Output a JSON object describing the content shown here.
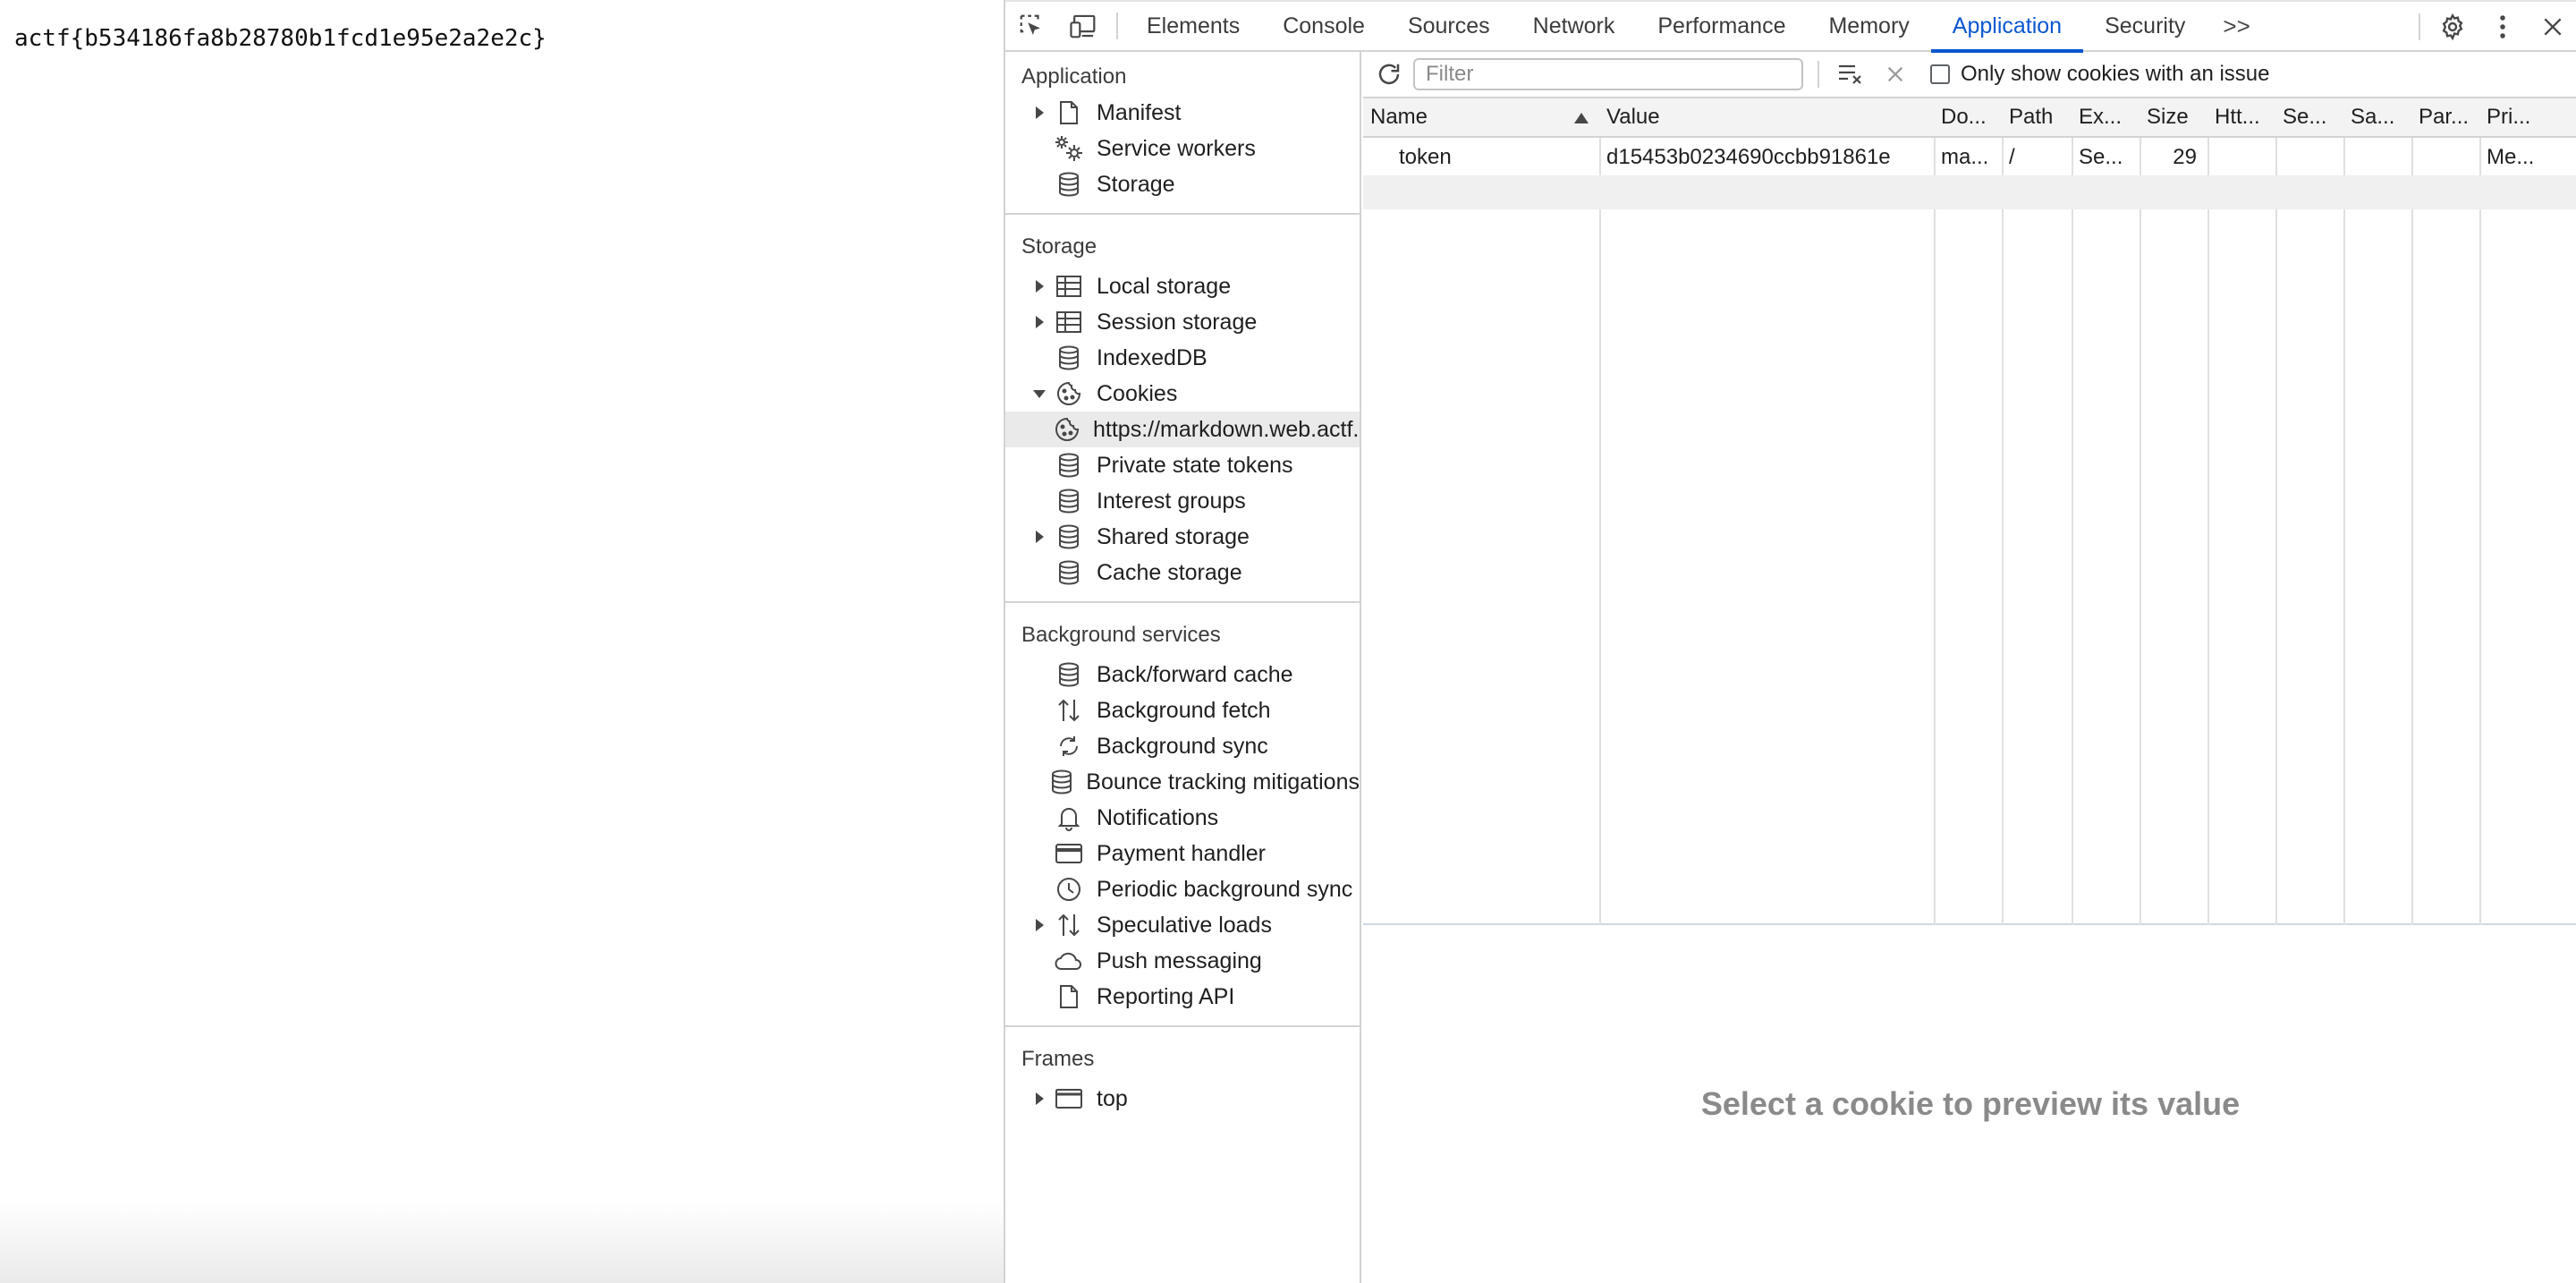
{
  "page": {
    "text": "actf{b534186fa8b28780b1fcd1e95e2a2e2c}"
  },
  "devtools": {
    "tabs": [
      "Elements",
      "Console",
      "Sources",
      "Network",
      "Performance",
      "Memory",
      "Application",
      "Security"
    ],
    "active_tab": "Application",
    "more_tabs": ">>",
    "icons": {
      "inspect": "inspect-element-icon",
      "device": "device-toolbar-icon",
      "settings": "gear-icon",
      "menu": "kebab-menu-icon",
      "close": "close-icon"
    },
    "accent_color": "#0b57d0"
  },
  "sidebar": {
    "application": {
      "title": "Application",
      "items": [
        "Manifest",
        "Service workers",
        "Storage"
      ]
    },
    "storage": {
      "title": "Storage",
      "items": [
        "Local storage",
        "Session storage",
        "IndexedDB",
        "Cookies",
        "https://markdown.web.actf.co",
        "Private state tokens",
        "Interest groups",
        "Shared storage",
        "Cache storage"
      ]
    },
    "background": {
      "title": "Background services",
      "items": [
        "Back/forward cache",
        "Background fetch",
        "Background sync",
        "Bounce tracking mitigations",
        "Notifications",
        "Payment handler",
        "Periodic background sync",
        "Speculative loads",
        "Push messaging",
        "Reporting API"
      ]
    },
    "frames": {
      "title": "Frames",
      "items": [
        "top"
      ]
    }
  },
  "cookies": {
    "filter_placeholder": "Filter",
    "only_issue_label": "Only show cookies with an issue",
    "columns": [
      "Name",
      "Value",
      "Do...",
      "Path",
      "Ex...",
      "Size",
      "Htt...",
      "Se...",
      "Sa...",
      "Par...",
      "Pri..."
    ],
    "rows": [
      {
        "name": "token",
        "value": "d15453b0234690ccbb91861e",
        "domain": "ma...",
        "path": "/",
        "expires": "Se...",
        "size": "29",
        "httponly": "",
        "secure": "",
        "samesite": "",
        "partition": "",
        "priority": "Me..."
      }
    ],
    "preview_text": "Select a cookie to preview its value"
  }
}
